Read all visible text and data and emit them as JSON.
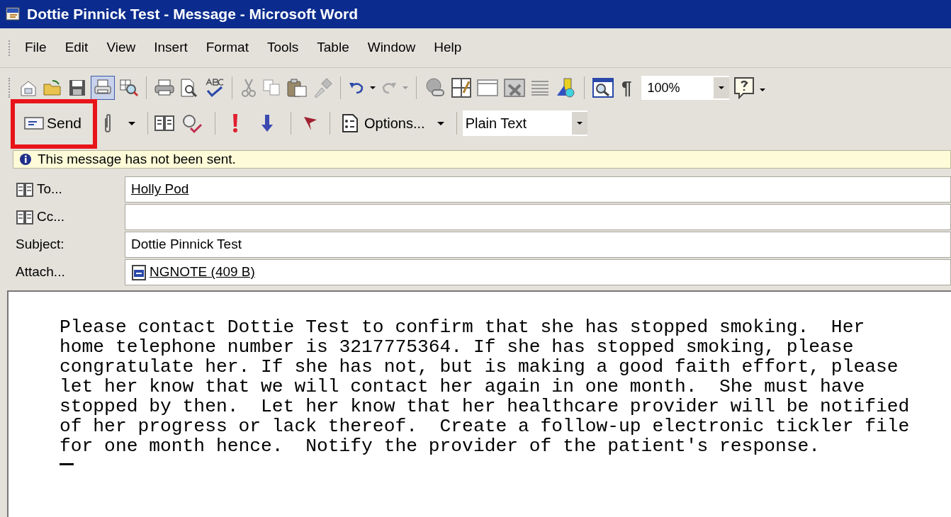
{
  "window": {
    "title": "Dottie Pinnick Test - Message - Microsoft Word"
  },
  "menu": [
    "File",
    "Edit",
    "View",
    "Insert",
    "Format",
    "Tools",
    "Table",
    "Window",
    "Help"
  ],
  "toolbar": {
    "show_all_mark": "¶",
    "zoom": "100%"
  },
  "email_toolbar": {
    "send": "Send",
    "options": "Options...",
    "format": "Plain Text"
  },
  "info_bar": "This message has not been sent.",
  "fields": [
    {
      "kind": "address",
      "label": "To...",
      "value": "Holly Pod"
    },
    {
      "kind": "address",
      "label": "Cc..."
    },
    {
      "kind": "text",
      "label": "Subject:",
      "value": "Dottie Pinnick Test"
    },
    {
      "kind": "attachment",
      "label": "Attach...",
      "value": "NGNOTE (409 B)"
    }
  ],
  "body": [
    "Please contact Dottie Test to confirm that she has stopped smoking.  Her",
    "home telephone number is 3217775364. If she has stopped smoking, please",
    "congratulate her. If she has not, but is making a good faith effort, please",
    "let her know that we will contact her again in one month.  She must have",
    "stopped by then.  Let her know that her healthcare provider will be notified",
    "of her progress or lack thereof.  Create a follow-up electronic tickler file",
    "for one month hence.  Notify the provider of the patient's response."
  ]
}
